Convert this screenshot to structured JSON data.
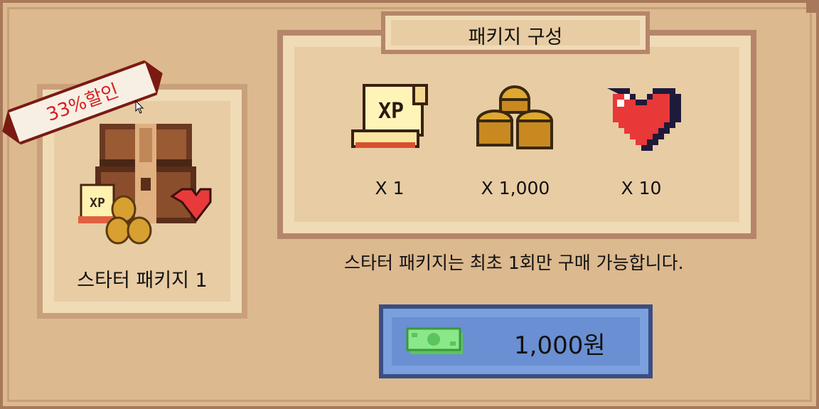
{
  "package": {
    "badge": "33%할인",
    "name": "스타터 패키지 1"
  },
  "contents": {
    "title": "패키지 구성",
    "items": [
      {
        "icon": "xp-scroll-icon",
        "qty": "X 1"
      },
      {
        "icon": "gold-coins-icon",
        "qty": "X 1,000"
      },
      {
        "icon": "heart-icon",
        "qty": "X 10"
      }
    ]
  },
  "notice": "스타터 패키지는 최초 1회만 구매 가능합니다.",
  "purchase": {
    "price": "1,000원",
    "icon": "cash-icon"
  },
  "colors": {
    "background": "#dcb98f",
    "panel_border": "#b5866a",
    "button": "#7aa0de",
    "badge_text": "#d72020"
  }
}
